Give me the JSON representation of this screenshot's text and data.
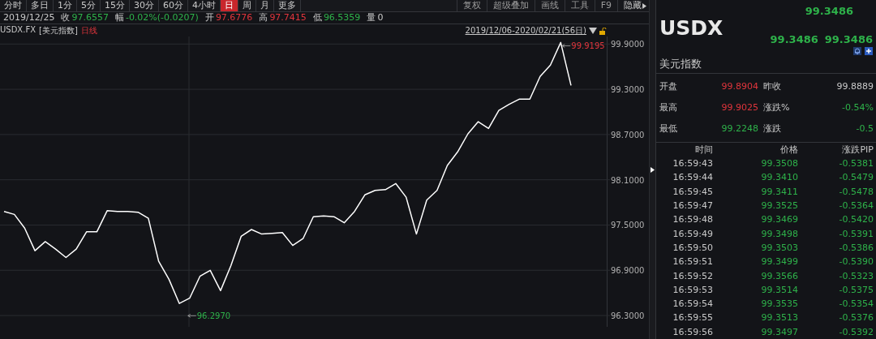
{
  "toolbar": {
    "periods": [
      {
        "label": "分时",
        "selected": false
      },
      {
        "label": "多日",
        "selected": false
      },
      {
        "label": "1分",
        "selected": false
      },
      {
        "label": "5分",
        "selected": false
      },
      {
        "label": "15分",
        "selected": false
      },
      {
        "label": "30分",
        "selected": false
      },
      {
        "label": "60分",
        "selected": false
      },
      {
        "label": "4小时",
        "selected": false
      },
      {
        "label": "日",
        "selected": true
      },
      {
        "label": "周",
        "selected": false
      },
      {
        "label": "月",
        "selected": false
      },
      {
        "label": "更多",
        "selected": false
      }
    ],
    "tools": [
      "复权",
      "超级叠加",
      "画线",
      "工具",
      "F9"
    ],
    "hide_button": "隐藏"
  },
  "info_bar": {
    "date": "2019/12/25",
    "fields": [
      {
        "label": "收",
        "value": "97.6557",
        "color": "#2eb24a"
      },
      {
        "label": "幅",
        "value": "-0.02%(-0.0207)",
        "color": "#2eb24a"
      },
      {
        "label": "开",
        "value": "97.6776",
        "color": "#e0353c"
      },
      {
        "label": "高",
        "value": "97.7415",
        "color": "#e0353c"
      },
      {
        "label": "低",
        "value": "96.5359",
        "color": "#2eb24a"
      },
      {
        "label": "量",
        "value": "0"
      }
    ]
  },
  "chart_header": {
    "symbol": "USDX.FX",
    "name": "[美元指数]",
    "period": "日线",
    "range": "2019/12/06-2020/02/21(56日)"
  },
  "chart_data": {
    "type": "line",
    "grid": true,
    "ylim": [
      96.15,
      100.0
    ],
    "yticks": [
      {
        "value": 99.9,
        "label": "99.9000"
      },
      {
        "value": 99.3,
        "label": "99.3000"
      },
      {
        "value": 98.7,
        "label": "98.7000"
      },
      {
        "value": 98.1,
        "label": "98.1000"
      },
      {
        "value": 97.5,
        "label": "97.5000"
      },
      {
        "value": 96.9,
        "label": "96.9000"
      },
      {
        "value": 96.3,
        "label": "96.3000"
      }
    ],
    "values": [
      97.68,
      97.64,
      97.46,
      97.16,
      97.28,
      97.18,
      97.07,
      97.18,
      97.41,
      97.41,
      97.69,
      97.68,
      97.68,
      97.67,
      97.59,
      97.02,
      96.78,
      96.46,
      96.53,
      96.82,
      96.9,
      96.63,
      96.96,
      97.35,
      97.44,
      97.38,
      97.39,
      97.4,
      97.23,
      97.32,
      97.61,
      97.62,
      97.61,
      97.53,
      97.68,
      97.9,
      97.96,
      97.97,
      98.05,
      97.87,
      97.38,
      97.83,
      97.96,
      98.29,
      98.47,
      98.71,
      98.87,
      98.78,
      99.02,
      99.1,
      99.17,
      99.17,
      99.47,
      99.62,
      99.92,
      99.35
    ],
    "annotations": [
      "99.9195",
      "96.2970"
    ]
  },
  "quote": {
    "symbol": "USDX",
    "last": "99.3486",
    "bid": "99.3486",
    "ask": "99.3486",
    "name": "美元指数"
  },
  "stats": [
    {
      "label": "开盘",
      "value": "99.8904",
      "color": "#e0353c"
    },
    {
      "label": "昨收",
      "value": "99.8889",
      "color": "#c9c9c9"
    },
    {
      "label": "最高",
      "value": "99.9025",
      "color": "#e0353c"
    },
    {
      "label": "涨跌%",
      "value": "-0.54%",
      "color": "#2eb24a"
    },
    {
      "label": "最低",
      "value": "99.2248",
      "color": "#2eb24a"
    },
    {
      "label": "涨跌",
      "value": "-0.5",
      "color": "#2eb24a"
    }
  ],
  "ticks": {
    "columns": [
      "时间",
      "价格",
      "涨跌PIP"
    ],
    "rows": [
      [
        "16:59:43",
        "99.3508",
        "-0.5381"
      ],
      [
        "16:59:44",
        "99.3410",
        "-0.5479"
      ],
      [
        "16:59:45",
        "99.3411",
        "-0.5478"
      ],
      [
        "16:59:47",
        "99.3525",
        "-0.5364"
      ],
      [
        "16:59:48",
        "99.3469",
        "-0.5420"
      ],
      [
        "16:59:49",
        "99.3498",
        "-0.5391"
      ],
      [
        "16:59:50",
        "99.3503",
        "-0.5386"
      ],
      [
        "16:59:51",
        "99.3499",
        "-0.5390"
      ],
      [
        "16:59:52",
        "99.3566",
        "-0.5323"
      ],
      [
        "16:59:53",
        "99.3514",
        "-0.5375"
      ],
      [
        "16:59:54",
        "99.3535",
        "-0.5354"
      ],
      [
        "16:59:55",
        "99.3513",
        "-0.5376"
      ],
      [
        "16:59:56",
        "99.3497",
        "-0.5392"
      ]
    ]
  }
}
